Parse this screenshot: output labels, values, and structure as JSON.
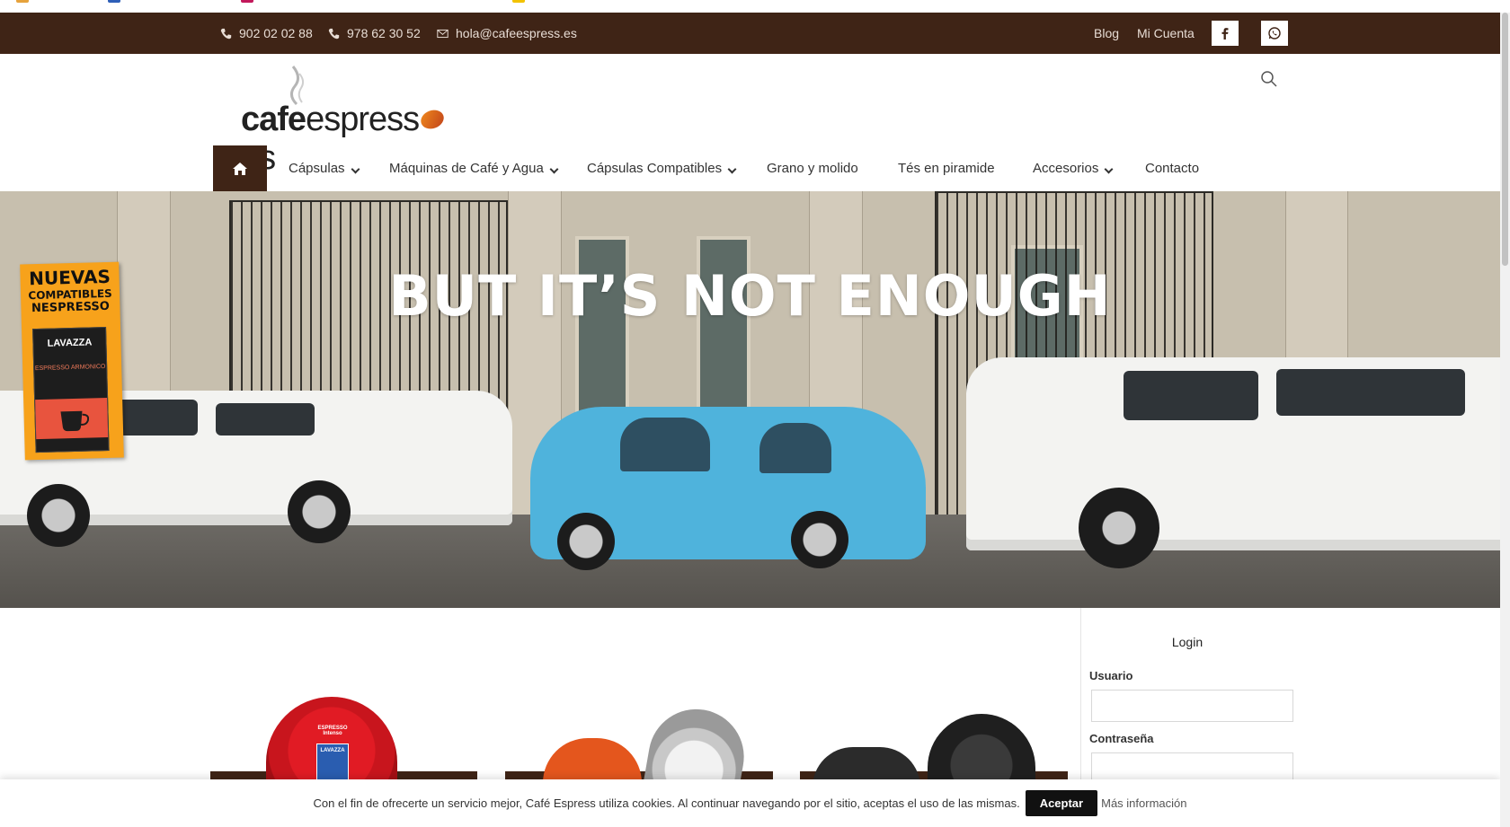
{
  "topbar": {
    "phone1": "902 02 02 88",
    "phone2": "978 62 30 52",
    "email": "hola@cafeespress.es",
    "blog": "Blog",
    "account": "Mi Cuenta",
    "background": "#3f2416"
  },
  "logo": {
    "part_bold": "cafe",
    "part_light": "espress",
    "part_end": "es"
  },
  "nav": {
    "items": [
      {
        "label": "Cápsulas",
        "dropdown": true
      },
      {
        "label": "Máquinas de Café y Agua",
        "dropdown": true
      },
      {
        "label": "Cápsulas Compatibles",
        "dropdown": true
      },
      {
        "label": "Grano y molido",
        "dropdown": false
      },
      {
        "label": "Tés en piramide",
        "dropdown": false
      },
      {
        "label": "Accesorios",
        "dropdown": true
      },
      {
        "label": "Contacto",
        "dropdown": false
      }
    ]
  },
  "hero": {
    "title": "BUT IT’S NOT ENOUGH",
    "promo": {
      "line1": "NUEVAS",
      "line2": "COMPATIBLES",
      "line3": "NESPRESSO",
      "brand": "LAVAZZA",
      "product": "ESPRESSO ARMONICO"
    }
  },
  "products": {
    "cap1_label": "ESPRESSO Intenso",
    "cap1_brand": "LAVAZZA"
  },
  "login": {
    "title": "Login",
    "username_label": "Usuario",
    "password_label": "Contraseña"
  },
  "cookie": {
    "text": "Con el fin de ofrecerte un servicio mejor, Café Espress utiliza cookies. Al continuar navegando por el sitio, aceptas el uso de las mismas.",
    "accept": "Aceptar",
    "more": "Más información"
  },
  "icons": {
    "phone": "phone-icon",
    "email": "envelope-icon",
    "facebook": "facebook-icon",
    "whatsapp": "whatsapp-icon",
    "search": "search-icon",
    "home": "home-icon"
  }
}
